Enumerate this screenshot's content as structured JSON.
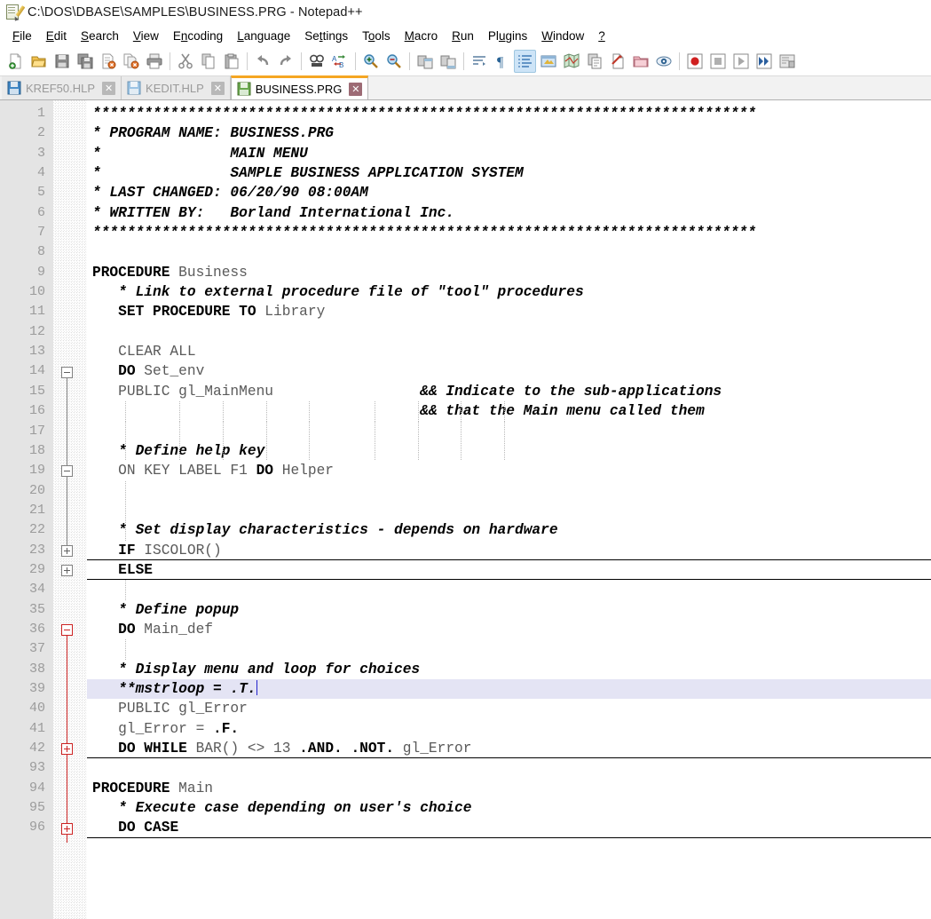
{
  "window": {
    "title": "C:\\DOS\\DBASE\\SAMPLES\\BUSINESS.PRG - Notepad++",
    "app_icon": "notepad-plus-plus-icon"
  },
  "menu": {
    "items": [
      {
        "label": "File",
        "accel": "F"
      },
      {
        "label": "Edit",
        "accel": "E"
      },
      {
        "label": "Search",
        "accel": "S"
      },
      {
        "label": "View",
        "accel": "V"
      },
      {
        "label": "Encoding",
        "accel": "n"
      },
      {
        "label": "Language",
        "accel": "L"
      },
      {
        "label": "Settings",
        "accel": "t"
      },
      {
        "label": "Tools",
        "accel": "o"
      },
      {
        "label": "Macro",
        "accel": "M"
      },
      {
        "label": "Run",
        "accel": "R"
      },
      {
        "label": "Plugins",
        "accel": "u"
      },
      {
        "label": "Window",
        "accel": "W"
      },
      {
        "label": "?",
        "accel": "?"
      }
    ]
  },
  "toolbar": {
    "buttons": [
      {
        "name": "new-file-icon",
        "title": "New"
      },
      {
        "name": "open-file-icon",
        "title": "Open"
      },
      {
        "name": "save-icon",
        "title": "Save"
      },
      {
        "name": "save-all-icon",
        "title": "Save All"
      },
      {
        "name": "close-file-icon",
        "title": "Close"
      },
      {
        "name": "close-all-files-icon",
        "title": "Close All"
      },
      {
        "name": "print-icon",
        "title": "Print"
      },
      {
        "name": "separator",
        "title": ""
      },
      {
        "name": "cut-icon",
        "title": "Cut"
      },
      {
        "name": "copy-icon",
        "title": "Copy"
      },
      {
        "name": "paste-icon",
        "title": "Paste"
      },
      {
        "name": "separator",
        "title": ""
      },
      {
        "name": "undo-icon",
        "title": "Undo"
      },
      {
        "name": "redo-icon",
        "title": "Redo"
      },
      {
        "name": "separator",
        "title": ""
      },
      {
        "name": "find-icon",
        "title": "Find"
      },
      {
        "name": "replace-icon",
        "title": "Replace"
      },
      {
        "name": "separator",
        "title": ""
      },
      {
        "name": "zoom-in-icon",
        "title": "Zoom In"
      },
      {
        "name": "zoom-out-icon",
        "title": "Zoom Out"
      },
      {
        "name": "separator",
        "title": ""
      },
      {
        "name": "sync-vertical-scrolling-icon",
        "title": "Synchronize Vertical Scrolling"
      },
      {
        "name": "sync-horizontal-scrolling-icon",
        "title": "Synchronize Horizontal Scrolling"
      },
      {
        "name": "separator",
        "title": ""
      },
      {
        "name": "word-wrap-icon",
        "title": "Word wrap"
      },
      {
        "name": "show-all-characters-icon",
        "title": "Show All Characters"
      },
      {
        "name": "show-indent-guide-icon",
        "title": "Show Indent Guide",
        "active": true
      },
      {
        "name": "user-defined-language-icon",
        "title": "User-Defined Dialogue"
      },
      {
        "name": "show-document-map-icon",
        "title": "Document Map"
      },
      {
        "name": "function-list-icon",
        "title": "Function List"
      },
      {
        "name": "document-switcher-icon",
        "title": "Document Switcher"
      },
      {
        "name": "folder-as-workspace-icon",
        "title": "Folder as Workspace"
      },
      {
        "name": "monitoring-icon",
        "title": "Monitoring"
      },
      {
        "name": "separator",
        "title": ""
      },
      {
        "name": "record-macro-icon",
        "title": "Start Recording"
      },
      {
        "name": "stop-macro-icon",
        "title": "Stop Recording"
      },
      {
        "name": "play-macro-icon",
        "title": "Playback"
      },
      {
        "name": "run-macro-multiple-icon",
        "title": "Run a Macro Multiple Times"
      },
      {
        "name": "save-macro-icon",
        "title": "Save Current Recorded Macro"
      }
    ]
  },
  "tabs": [
    {
      "label": "KREF50.HLP",
      "active": false,
      "icon": "saved-document-icon",
      "close": "✕"
    },
    {
      "label": "KEDIT.HLP",
      "active": false,
      "icon": "saved-document-icon",
      "close": "✕"
    },
    {
      "label": "BUSINESS.PRG",
      "active": true,
      "icon": "saved-document-icon",
      "close": "✕"
    }
  ],
  "editor": {
    "current_line": 39,
    "line_numbers": [
      1,
      2,
      3,
      4,
      5,
      6,
      7,
      8,
      9,
      10,
      11,
      12,
      13,
      14,
      15,
      16,
      17,
      18,
      19,
      20,
      21,
      22,
      23,
      29,
      34,
      35,
      36,
      37,
      38,
      39,
      40,
      41,
      42,
      93,
      94,
      95,
      96
    ],
    "lines": [
      {
        "n": 1,
        "tokens": [
          {
            "t": "cmt",
            "v": "*****************************************************************************"
          }
        ]
      },
      {
        "n": 2,
        "tokens": [
          {
            "t": "cmt",
            "v": "* PROGRAM NAME: BUSINESS.PRG"
          }
        ]
      },
      {
        "n": 3,
        "tokens": [
          {
            "t": "cmt",
            "v": "*               MAIN MENU"
          }
        ]
      },
      {
        "n": 4,
        "tokens": [
          {
            "t": "cmt",
            "v": "*               SAMPLE BUSINESS APPLICATION SYSTEM"
          }
        ]
      },
      {
        "n": 5,
        "tokens": [
          {
            "t": "cmt",
            "v": "* LAST CHANGED: 06/20/90 08:00AM"
          }
        ]
      },
      {
        "n": 6,
        "tokens": [
          {
            "t": "cmt",
            "v": "* WRITTEN BY:   Borland International Inc."
          }
        ]
      },
      {
        "n": 7,
        "tokens": [
          {
            "t": "cmt",
            "v": "*****************************************************************************"
          }
        ]
      },
      {
        "n": 8,
        "tokens": []
      },
      {
        "n": 9,
        "tokens": [
          {
            "t": "kw",
            "v": "PROCEDURE"
          },
          {
            "t": "id",
            "v": " Business"
          }
        ]
      },
      {
        "n": 10,
        "tokens": [
          {
            "t": "cmt",
            "v": "   * Link to external procedure file of \"tool\" procedures"
          }
        ]
      },
      {
        "n": 11,
        "tokens": [
          {
            "t": "id",
            "v": "   "
          },
          {
            "t": "kw",
            "v": "SET PROCEDURE TO"
          },
          {
            "t": "id",
            "v": " Library"
          }
        ]
      },
      {
        "n": 12,
        "tokens": []
      },
      {
        "n": 13,
        "tokens": [
          {
            "t": "id",
            "v": "   CLEAR ALL"
          }
        ]
      },
      {
        "n": 14,
        "tokens": [
          {
            "t": "id",
            "v": "   "
          },
          {
            "t": "kw",
            "v": "DO"
          },
          {
            "t": "id",
            "v": " Set_env"
          }
        ]
      },
      {
        "n": 15,
        "tokens": [
          {
            "t": "id",
            "v": "   PUBLIC gl_MainMenu"
          },
          {
            "t": "pad",
            "v": "                 "
          },
          {
            "t": "cmt",
            "v": "&& Indicate to the sub-applications"
          }
        ]
      },
      {
        "n": 16,
        "tokens": [
          {
            "t": "pad",
            "v": "                                      "
          },
          {
            "t": "cmt",
            "v": "&& that the Main menu called them"
          }
        ]
      },
      {
        "n": 17,
        "tokens": []
      },
      {
        "n": 18,
        "tokens": [
          {
            "t": "cmt",
            "v": "   * Define help key"
          }
        ]
      },
      {
        "n": 19,
        "tokens": [
          {
            "t": "id",
            "v": "   ON KEY LABEL F1 "
          },
          {
            "t": "kw",
            "v": "DO"
          },
          {
            "t": "id",
            "v": " Helper"
          }
        ]
      },
      {
        "n": 20,
        "tokens": []
      },
      {
        "n": 21,
        "tokens": []
      },
      {
        "n": 22,
        "tokens": [
          {
            "t": "cmt",
            "v": "   * Set display characteristics - depends on hardware"
          }
        ]
      },
      {
        "n": 23,
        "tokens": [
          {
            "t": "id",
            "v": "   "
          },
          {
            "t": "kw",
            "v": "IF"
          },
          {
            "t": "id",
            "v": " ISCOLOR()"
          }
        ],
        "fold_end": true
      },
      {
        "n": 29,
        "tokens": [
          {
            "t": "id",
            "v": "   "
          },
          {
            "t": "kw",
            "v": "ELSE"
          }
        ],
        "fold_end": true
      },
      {
        "n": 34,
        "tokens": []
      },
      {
        "n": 35,
        "tokens": [
          {
            "t": "cmt",
            "v": "   * Define popup"
          }
        ]
      },
      {
        "n": 36,
        "tokens": [
          {
            "t": "id",
            "v": "   "
          },
          {
            "t": "kw",
            "v": "DO"
          },
          {
            "t": "id",
            "v": " Main_def"
          }
        ]
      },
      {
        "n": 37,
        "tokens": []
      },
      {
        "n": 38,
        "tokens": [
          {
            "t": "cmt",
            "v": "   * Display menu and loop for choices"
          }
        ]
      },
      {
        "n": 39,
        "tokens": [
          {
            "t": "cmt",
            "v": "   **mstrloop = .T."
          }
        ],
        "caret": true
      },
      {
        "n": 40,
        "tokens": [
          {
            "t": "id",
            "v": "   PUBLIC gl_Error"
          }
        ]
      },
      {
        "n": 41,
        "tokens": [
          {
            "t": "id",
            "v": "   gl_Error = "
          },
          {
            "t": "kw",
            "v": ".F."
          }
        ]
      },
      {
        "n": 42,
        "tokens": [
          {
            "t": "id",
            "v": "   "
          },
          {
            "t": "kw",
            "v": "DO WHILE"
          },
          {
            "t": "id",
            "v": " BAR() <> 13 "
          },
          {
            "t": "kw",
            "v": ".AND."
          },
          {
            "t": "id",
            "v": " "
          },
          {
            "t": "kw",
            "v": ".NOT."
          },
          {
            "t": "id",
            "v": " gl_Error"
          }
        ],
        "fold_end": true
      },
      {
        "n": 93,
        "tokens": []
      },
      {
        "n": 94,
        "tokens": [
          {
            "t": "kw",
            "v": "PROCEDURE"
          },
          {
            "t": "id",
            "v": " Main"
          }
        ]
      },
      {
        "n": 95,
        "tokens": [
          {
            "t": "cmt",
            "v": "   * Execute case depending on user's choice"
          }
        ]
      },
      {
        "n": 96,
        "tokens": [
          {
            "t": "id",
            "v": "   "
          },
          {
            "t": "kw",
            "v": "DO CASE"
          }
        ],
        "fold_end": true
      }
    ],
    "fold_markers": [
      {
        "row": 13,
        "type": "minus",
        "color": "gray"
      },
      {
        "row": 18,
        "type": "minus",
        "color": "gray"
      },
      {
        "row": 22,
        "type": "plus",
        "color": "gray"
      },
      {
        "row": 23,
        "type": "plus",
        "color": "gray"
      },
      {
        "row": 26,
        "type": "minus",
        "color": "red"
      },
      {
        "row": 32,
        "type": "plus",
        "color": "red"
      },
      {
        "row": 36,
        "type": "plus",
        "color": "red"
      }
    ]
  },
  "colors": {
    "accent_tab": "#f5a623",
    "current_line": "#e4e4f4",
    "gutter_bg": "#e4e4e4",
    "linenum_fg": "#9b9b9b",
    "keyword_fg": "#000000",
    "identifier_fg": "#5a5a5a",
    "comment_fg": "#000000",
    "fold_red": "#cc2222",
    "caret": "#2222cc"
  }
}
